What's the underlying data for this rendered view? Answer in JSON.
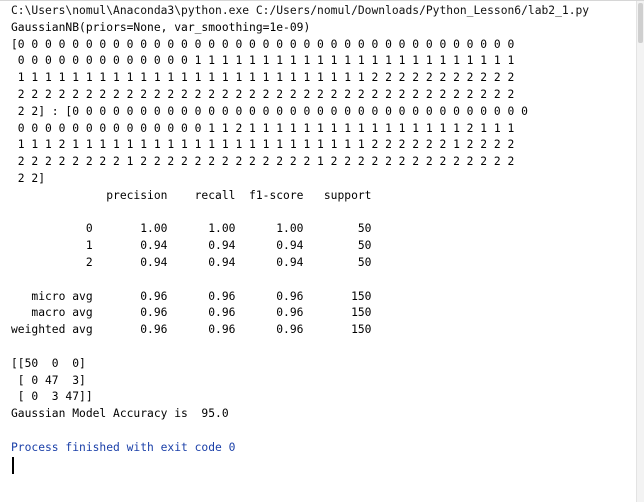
{
  "console": {
    "command": "C:\\Users\\nomul\\Anaconda3\\python.exe C:/Users/nomul/Downloads/Python_Lesson6/lab2_1.py",
    "lines": [
      "GaussianNB(priors=None, var_smoothing=1e-09)",
      "[0 0 0 0 0 0 0 0 0 0 0 0 0 0 0 0 0 0 0 0 0 0 0 0 0 0 0 0 0 0 0 0 0 0 0 0 0",
      " 0 0 0 0 0 0 0 0 0 0 0 0 0 1 1 1 1 1 1 1 1 1 1 1 1 1 1 1 1 1 1 1 1 1 1 1 1",
      " 1 1 1 1 1 1 1 1 1 1 1 1 1 1 1 1 1 1 1 1 1 1 1 1 1 1 2 2 2 2 2 2 2 2 2 2 2",
      " 2 2 2 2 2 2 2 2 2 2 2 2 2 2 2 2 2 2 2 2 2 2 2 2 2 2 2 2 2 2 2 2 2 2 2 2 2",
      " 2 2] : [0 0 0 0 0 0 0 0 0 0 0 0 0 0 0 0 0 0 0 0 0 0 0 0 0 0 0 0 0 0 0 0 0 0",
      " 0 0 0 0 0 0 0 0 0 0 0 0 0 0 1 1 2 1 1 1 1 1 1 1 1 1 1 1 1 1 1 1 1 2 1 1 1",
      " 1 1 1 2 1 1 1 1 1 1 1 1 1 1 1 1 1 1 1 1 1 1 1 1 1 1 2 2 2 2 2 2 1 2 2 2 2",
      " 2 2 2 2 2 2 2 2 1 2 2 2 2 2 2 2 2 2 2 2 2 2 1 2 2 2 2 2 2 2 2 2 2 2 2 2 2",
      " 2 2]",
      "              precision    recall  f1-score   support",
      "",
      "           0       1.00      1.00      1.00        50",
      "           1       0.94      0.94      0.94        50",
      "           2       0.94      0.94      0.94        50",
      "",
      "   micro avg       0.96      0.96      0.96       150",
      "   macro avg       0.96      0.96      0.96       150",
      "weighted avg       0.96      0.96      0.96       150",
      "",
      "[[50  0  0]",
      " [ 0 47  3]",
      " [ 0  3 47]]",
      "Gaussian Model Accuracy is  95.0",
      ""
    ],
    "exit_message": "Process finished with exit code 0"
  },
  "colors": {
    "background": "#ffffff",
    "text": "#000000",
    "exit_text": "#1a3fa8"
  }
}
